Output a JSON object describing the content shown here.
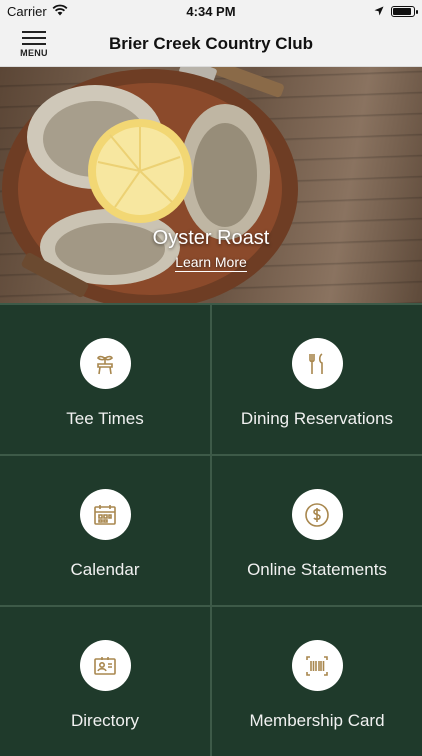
{
  "status": {
    "carrier": "Carrier",
    "time": "4:34 PM",
    "battery_level": 0.9
  },
  "navbar": {
    "menu_label": "MENU",
    "title": "Brier Creek Country Club"
  },
  "hero": {
    "title": "Oyster Roast",
    "link": "Learn More"
  },
  "tiles": [
    {
      "label": "Tee Times",
      "icon": "tee-times-icon"
    },
    {
      "label": "Dining Reservations",
      "icon": "dining-icon"
    },
    {
      "label": "Calendar",
      "icon": "calendar-icon"
    },
    {
      "label": "Online Statements",
      "icon": "dollar-icon"
    },
    {
      "label": "Directory",
      "icon": "directory-icon"
    },
    {
      "label": "Membership Card",
      "icon": "barcode-icon"
    }
  ],
  "colors": {
    "tile_bg": "#1f3a2b",
    "icon_accent": "#a8874e",
    "grid_line": "#3d5a48"
  }
}
